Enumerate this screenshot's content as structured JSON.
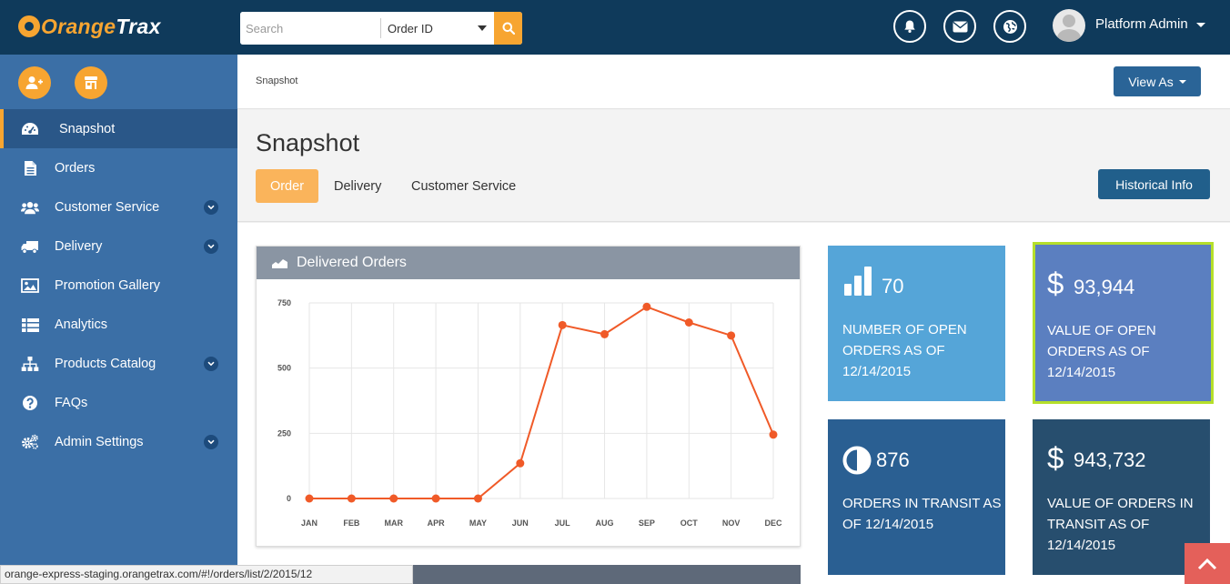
{
  "app": {
    "logo_part1": "Orange",
    "logo_part2": "Trax"
  },
  "search": {
    "placeholder": "Search",
    "type_selected": "Order ID"
  },
  "header": {
    "icons": [
      "bell-icon",
      "envelope-icon",
      "globe-icon"
    ],
    "user_name": "Platform Admin"
  },
  "sidebar": {
    "quick_actions": [
      "add-user-icon",
      "store-icon"
    ],
    "items": [
      {
        "label": "Snapshot",
        "icon": "dashboard-gauge-icon",
        "active": true,
        "has_submenu": false
      },
      {
        "label": "Orders",
        "icon": "document-icon",
        "active": false,
        "has_submenu": false
      },
      {
        "label": "Customer Service",
        "icon": "users-icon",
        "active": false,
        "has_submenu": true
      },
      {
        "label": "Delivery",
        "icon": "truck-icon",
        "active": false,
        "has_submenu": true
      },
      {
        "label": "Promotion Gallery",
        "icon": "image-icon",
        "active": false,
        "has_submenu": false
      },
      {
        "label": "Analytics",
        "icon": "list-icon",
        "active": false,
        "has_submenu": false
      },
      {
        "label": "Products Catalog",
        "icon": "sitemap-icon",
        "active": false,
        "has_submenu": true
      },
      {
        "label": "FAQs",
        "icon": "question-icon",
        "active": false,
        "has_submenu": false
      },
      {
        "label": "Admin Settings",
        "icon": "cogs-icon",
        "active": false,
        "has_submenu": true
      }
    ]
  },
  "main": {
    "breadcrumb": "Snapshot",
    "view_as_label": "View As",
    "page_title": "Snapshot",
    "tabs": [
      {
        "label": "Order",
        "active": true
      },
      {
        "label": "Delivery",
        "active": false
      },
      {
        "label": "Customer Service",
        "active": false
      }
    ],
    "historical_info_label": "Historical Info"
  },
  "chart_panel": {
    "title": "Delivered Orders"
  },
  "chart_data": {
    "type": "line",
    "title": "Delivered Orders",
    "categories": [
      "JAN",
      "FEB",
      "MAR",
      "APR",
      "MAY",
      "JUN",
      "JUL",
      "AUG",
      "SEP",
      "OCT",
      "NOV",
      "DEC"
    ],
    "values": [
      0,
      0,
      0,
      0,
      0,
      135,
      665,
      630,
      735,
      675,
      625,
      245
    ],
    "ylim": [
      0,
      750
    ],
    "yticks": [
      "0",
      "250",
      "500",
      "750"
    ],
    "grid": true,
    "line_color": "#f05a28"
  },
  "tiles": [
    {
      "value": "70",
      "label": "NUMBER OF OPEN ORDERS AS OF 12/14/2015",
      "icon": "bar-chart-icon",
      "color": "#55a5d8"
    },
    {
      "value": "93,944",
      "label": "VALUE OF OPEN ORDERS AS OF 12/14/2015",
      "icon": "dollar-icon",
      "color": "#5b7fc0",
      "highlight": "#b5df2a"
    },
    {
      "value": "876",
      "label": "ORDERS IN TRANSIT AS OF 12/14/2015",
      "icon": "half-circle-icon",
      "color": "#2a5f92"
    },
    {
      "value": "943,732",
      "label": "VALUE OF ORDERS IN TRANSIT AS OF 12/14/2015",
      "icon": "dollar-icon",
      "color": "#274e6e"
    }
  ],
  "status_bar": {
    "url": "orange-express-staging.orangetrax.com/#!/orders/list/2/2015/12"
  },
  "dollar_sign": "$"
}
